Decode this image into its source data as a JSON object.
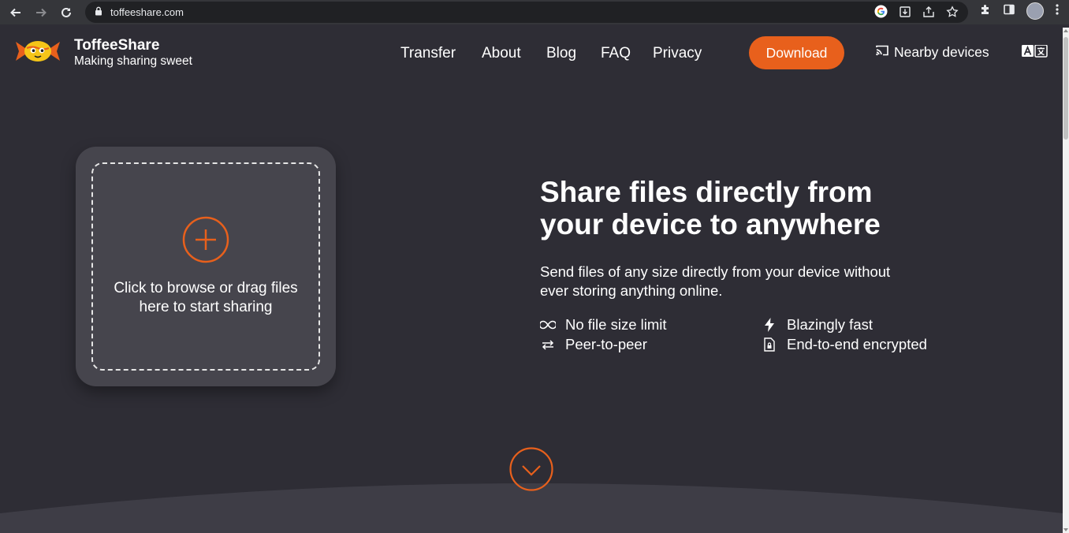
{
  "browser": {
    "url": "toffeeshare.com",
    "icons": [
      "back-arrow-icon",
      "forward-arrow-icon",
      "reload-icon",
      "lock-icon",
      "google-icon",
      "install-icon",
      "share-icon",
      "star-icon",
      "extensions-icon",
      "side-panel-icon",
      "profile-avatar",
      "menu-icon"
    ]
  },
  "header": {
    "brand_name": "ToffeeShare",
    "brand_tagline": "Making sharing sweet",
    "nav": [
      {
        "label": "Transfer"
      },
      {
        "label": "About"
      },
      {
        "label": "Blog"
      },
      {
        "label": "FAQ"
      },
      {
        "label": "Privacy"
      }
    ],
    "download_label": "Download",
    "nearby_label": "Nearby devices",
    "accent_color": "#e8601c"
  },
  "drop": {
    "text_line1": "Click to browse or drag files",
    "text_line2": "here to start sharing"
  },
  "hero": {
    "title_line1": "Share files directly from",
    "title_line2": "your device to anywhere",
    "subtitle_line1": "Send files of any size directly from your device without",
    "subtitle_line2": "ever storing anything online.",
    "features": [
      {
        "icon": "infinity-icon",
        "label": "No file size limit"
      },
      {
        "icon": "lightning-icon",
        "label": "Blazingly fast"
      },
      {
        "icon": "swap-arrows-icon",
        "label": "Peer-to-peer"
      },
      {
        "icon": "encrypted-file-icon",
        "label": "End-to-end encrypted"
      }
    ]
  }
}
